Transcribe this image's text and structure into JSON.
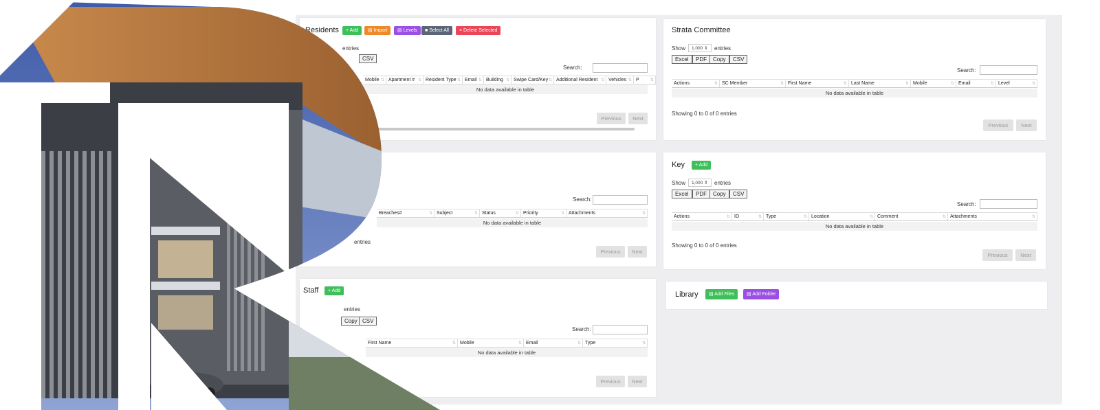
{
  "residents": {
    "title": "Residents",
    "buttons": {
      "add": "+ Add",
      "import": "Import",
      "levels": "Levels",
      "select_all": "Select All",
      "delete_selected": "× Delete Selected"
    },
    "entries": "entries",
    "export": {
      "csv": "CSV"
    },
    "search": "Search:",
    "columns": [
      "Mobile",
      "Apartment #",
      "Resident Type",
      "Email",
      "Building",
      "Swipe Card/Key",
      "Additional Resident",
      "Vehicles",
      "P"
    ],
    "empty": "No data available in table",
    "previous": "Previous",
    "next": "Next"
  },
  "breaches": {
    "search": "Search:",
    "columns": [
      "Breaches#",
      "Subject",
      "Status",
      "Priority",
      "Attachments"
    ],
    "empty": "No data available in table",
    "entries": "entries",
    "previous": "Previous",
    "next": "Next"
  },
  "staff": {
    "title": "Staff",
    "add": "+ Add",
    "entries": "entries",
    "export": {
      "copy": "Copy",
      "csv": "CSV"
    },
    "search": "Search:",
    "columns": [
      "First Name",
      "Mobile",
      "Email",
      "Type"
    ],
    "empty": "No data available in table",
    "previous": "Previous",
    "next": "Next"
  },
  "strata": {
    "title": "Strata Committee",
    "show": "Show",
    "show_value": "1,000",
    "entries": "entries",
    "export": {
      "excel": "Excel",
      "pdf": "PDF",
      "copy": "Copy",
      "csv": "CSV"
    },
    "search": "Search:",
    "columns": [
      "Actions",
      "SC Member",
      "First Name",
      "Last Name",
      "Mobile",
      "Email",
      "Level"
    ],
    "empty": "No data available in table",
    "info": "Showing 0 to 0 of 0 entries",
    "previous": "Previous",
    "next": "Next"
  },
  "key": {
    "title": "Key",
    "add": "+ Add",
    "show": "Show",
    "show_value": "1,000",
    "entries": "entries",
    "export": {
      "excel": "Excel",
      "pdf": "PDF",
      "copy": "Copy",
      "csv": "CSV"
    },
    "search": "Search:",
    "columns": [
      "Actions",
      "ID",
      "Type",
      "Location",
      "Comment",
      "Attachments"
    ],
    "empty": "No data available in table",
    "info": "Showing 0 to 0 of 0 entries",
    "previous": "Previous",
    "next": "Next"
  },
  "library": {
    "title": "Library",
    "add_files": "Add Files",
    "add_folder": "Add Folder"
  },
  "colors": {
    "green": "#3fbf5a",
    "orange": "#ef8a2b",
    "purple": "#9b4fe5",
    "slate": "#5a6578",
    "red": "#eb4557"
  }
}
